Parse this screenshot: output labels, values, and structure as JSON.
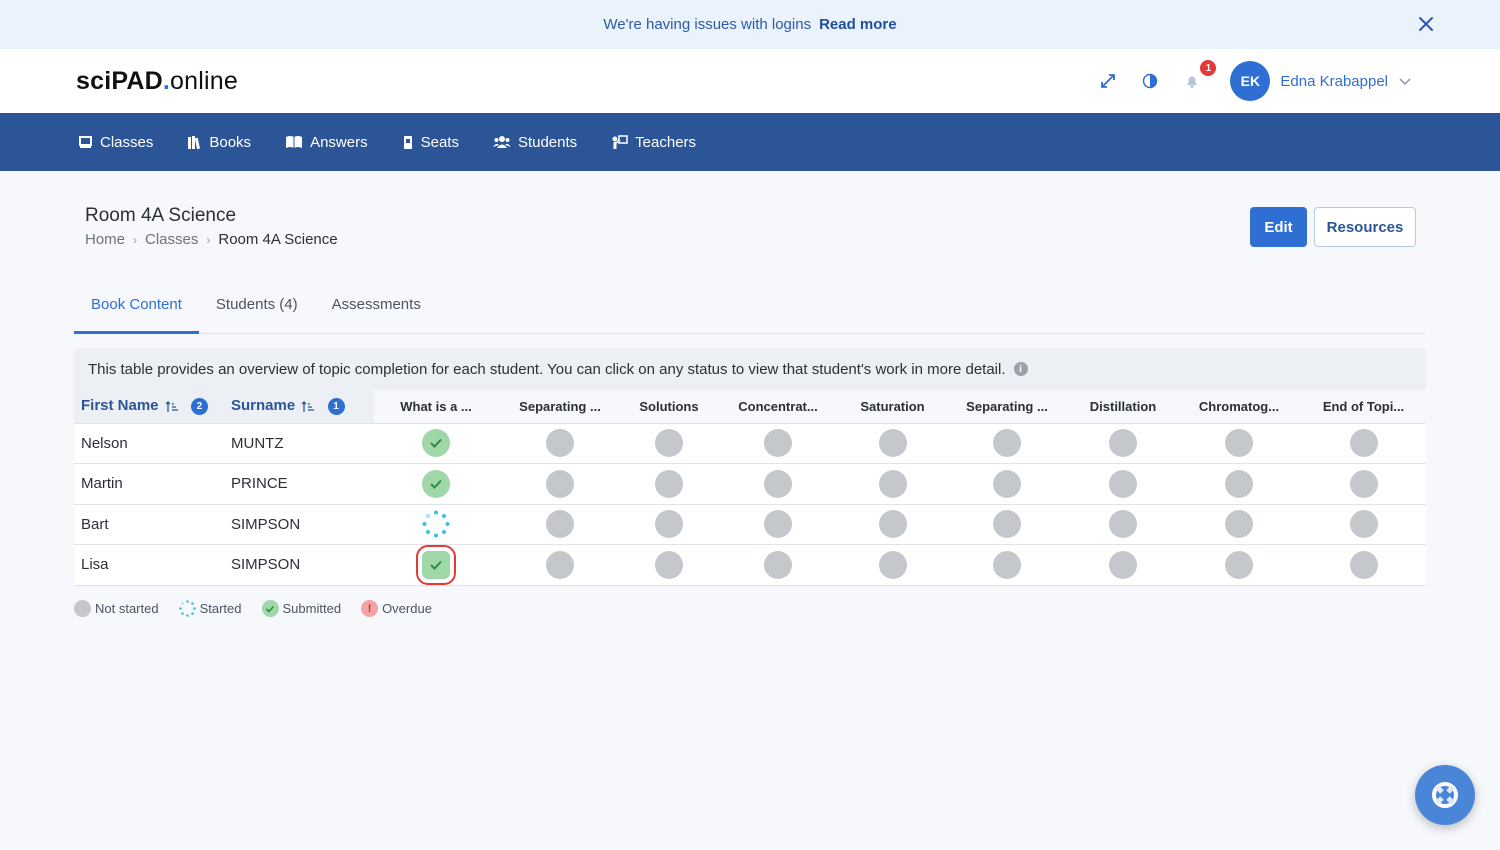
{
  "banner": {
    "message": "We're having issues with logins",
    "link": "Read more"
  },
  "header": {
    "logo_sci": "sci",
    "logo_pad": "PAD",
    "logo_dot": ".",
    "logo_online": "online",
    "notification_count": "1",
    "user_initials": "EK",
    "user_name": "Edna Krabappel"
  },
  "nav": {
    "items": [
      {
        "label": "Classes",
        "icon": "board-icon"
      },
      {
        "label": "Books",
        "icon": "books-icon"
      },
      {
        "label": "Answers",
        "icon": "open-book-icon"
      },
      {
        "label": "Seats",
        "icon": "seat-icon"
      },
      {
        "label": "Students",
        "icon": "students-icon"
      },
      {
        "label": "Teachers",
        "icon": "teacher-icon"
      }
    ]
  },
  "page": {
    "title": "Room 4A Science",
    "breadcrumb": [
      "Home",
      "Classes",
      "Room 4A Science"
    ],
    "edit_label": "Edit",
    "resources_label": "Resources"
  },
  "tabs": [
    "Book Content",
    "Students (4)",
    "Assessments"
  ],
  "info_text": "This table provides an overview of topic completion for each student. You can click on any status to view that student's work in more detail.",
  "table": {
    "col_first": "First Name",
    "col_first_badge": "2",
    "col_surname": "Surname",
    "col_surname_badge": "1",
    "topics": [
      "What is a ...",
      "Separating ...",
      "Solutions",
      "Concentrat...",
      "Saturation",
      "Separating ...",
      "Distillation",
      "Chromatog...",
      "End of Topi..."
    ],
    "rows": [
      {
        "first": "Nelson",
        "surname": "MUNTZ",
        "statuses": [
          "submitted",
          "not",
          "not",
          "not",
          "not",
          "not",
          "not",
          "not",
          "not"
        ]
      },
      {
        "first": "Martin",
        "surname": "PRINCE",
        "statuses": [
          "submitted",
          "not",
          "not",
          "not",
          "not",
          "not",
          "not",
          "not",
          "not"
        ]
      },
      {
        "first": "Bart",
        "surname": "SIMPSON",
        "statuses": [
          "started",
          "not",
          "not",
          "not",
          "not",
          "not",
          "not",
          "not",
          "not"
        ]
      },
      {
        "first": "Lisa",
        "surname": "SIMPSON",
        "statuses": [
          "submitted-selected",
          "not",
          "not",
          "not",
          "not",
          "not",
          "not",
          "not",
          "not"
        ]
      }
    ]
  },
  "legend": {
    "not_started": "Not started",
    "started": "Started",
    "submitted": "Submitted",
    "overdue": "Overdue"
  },
  "colors": {
    "primary": "#2f6fd4",
    "nav_bg": "#2c5597",
    "submitted": "#9fd7a8",
    "not_started": "#c4c7cc",
    "started": "#3cc0e8",
    "overdue": "#f08a8a",
    "selected_outline": "#e53935"
  }
}
